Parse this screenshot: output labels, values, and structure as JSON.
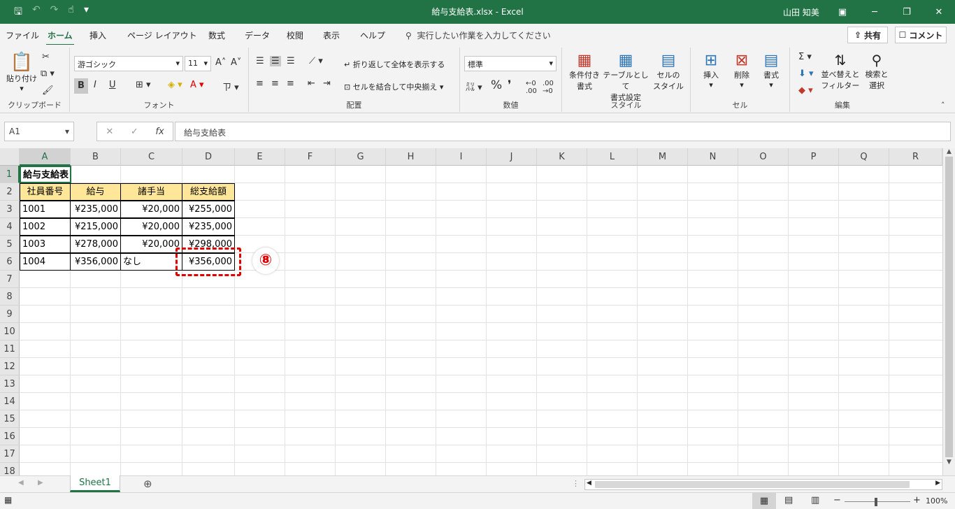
{
  "window": {
    "title": "給与支給表.xlsx  -  Excel",
    "user": "山田 知美"
  },
  "menu": {
    "tabs": [
      "ファイル",
      "ホーム",
      "挿入",
      "ページ レイアウト",
      "数式",
      "データ",
      "校閲",
      "表示",
      "ヘルプ"
    ],
    "active_tab": "ホーム",
    "tell_me": "実行したい作業を入力してください",
    "share": "共有",
    "comment": "コメント"
  },
  "ribbon": {
    "clipboard": {
      "paste": "貼り付け",
      "label": "クリップボード"
    },
    "font": {
      "name": "游ゴシック",
      "size": "11",
      "bold": "B",
      "italic": "I",
      "underline": "U",
      "label": "フォント"
    },
    "alignment": {
      "wrap": "折り返して全体を表示する",
      "merge": "セルを結合して中央揃え",
      "label": "配置"
    },
    "number": {
      "format": "標準",
      "percent": "%",
      "comma": "❜",
      "label": "数値"
    },
    "styles": {
      "conditional": "条件付き\n書式",
      "table": "テーブルとして\n書式設定",
      "cell": "セルの\nスタイル",
      "label": "スタイル"
    },
    "cells": {
      "insert": "挿入",
      "delete": "削除",
      "format": "書式",
      "label": "セル"
    },
    "editing": {
      "sort": "並べ替えと\nフィルター",
      "find": "検索と\n選択",
      "label": "編集"
    }
  },
  "formula_bar": {
    "name_box": "A1",
    "content": "給与支給表"
  },
  "columns": [
    "A",
    "B",
    "C",
    "D",
    "E",
    "F",
    "G",
    "H",
    "I",
    "J",
    "K",
    "L",
    "M",
    "N",
    "O",
    "P",
    "Q",
    "R"
  ],
  "rows": [
    "1",
    "2",
    "3",
    "4",
    "5",
    "6",
    "7",
    "8",
    "9",
    "10",
    "11",
    "12",
    "13",
    "14",
    "15",
    "16",
    "17",
    "18"
  ],
  "table": {
    "title": "給与支給表",
    "headers": [
      "社員番号",
      "給与",
      "諸手当",
      "総支給額"
    ],
    "rows": [
      [
        "1001",
        "¥235,000",
        "¥20,000",
        "¥255,000"
      ],
      [
        "1002",
        "¥215,000",
        "¥20,000",
        "¥235,000"
      ],
      [
        "1003",
        "¥278,000",
        "¥20,000",
        "¥298,000"
      ],
      [
        "1004",
        "¥356,000",
        "なし",
        "¥356,000"
      ]
    ]
  },
  "annotation": {
    "step": "⑧",
    "color": "#e00000"
  },
  "sheet_tabs": {
    "active": "Sheet1"
  },
  "status": {
    "zoom": "100%"
  },
  "accent_color": "#217346"
}
